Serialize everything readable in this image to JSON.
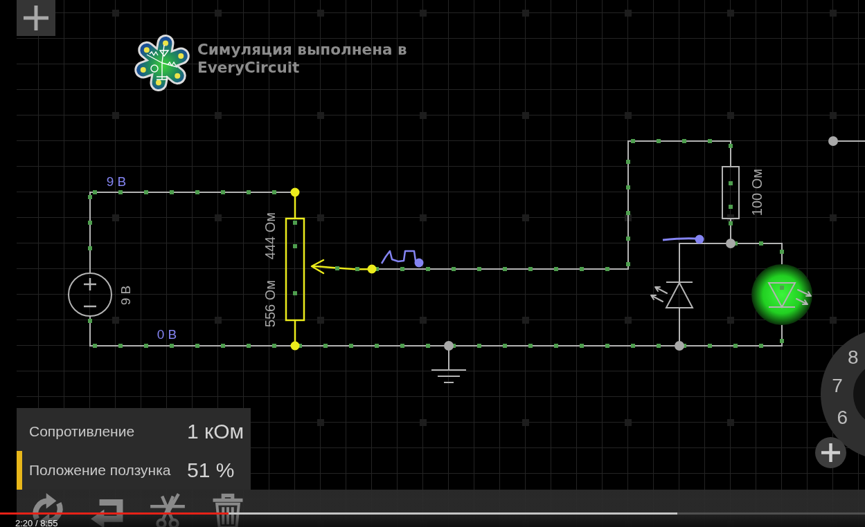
{
  "banner": {
    "text": "Симуляция выполнена в EveryCircuit"
  },
  "circuit": {
    "current_flowing": true,
    "node_labels": [
      {
        "text": "9 В"
      },
      {
        "text": "0 В"
      }
    ],
    "components": [
      {
        "kind": "battery",
        "label": "9 В",
        "selected": false
      },
      {
        "kind": "potentiometer",
        "labels": [
          "444 Ом",
          "556 Ом"
        ],
        "selected": true
      },
      {
        "kind": "ground",
        "selected": false
      },
      {
        "kind": "resistor",
        "label": "100 Ом",
        "selected": false
      },
      {
        "kind": "photodiode",
        "selected": false
      },
      {
        "kind": "led",
        "on": true,
        "selected": false
      }
    ]
  },
  "properties_panel": {
    "rows": [
      {
        "label": "Сопротивление",
        "value": "1 кОм",
        "selected": false
      },
      {
        "label": "Положение ползунка",
        "value": "51 %",
        "selected": true
      }
    ]
  },
  "dial": {
    "numbers": [
      "8",
      "7",
      "6"
    ]
  },
  "video_player": {
    "time": "2:20 / 8:55",
    "progress": [
      {
        "kind": "buffered",
        "level": 0.783
      },
      {
        "kind": "played",
        "level": 0.264
      }
    ]
  }
}
